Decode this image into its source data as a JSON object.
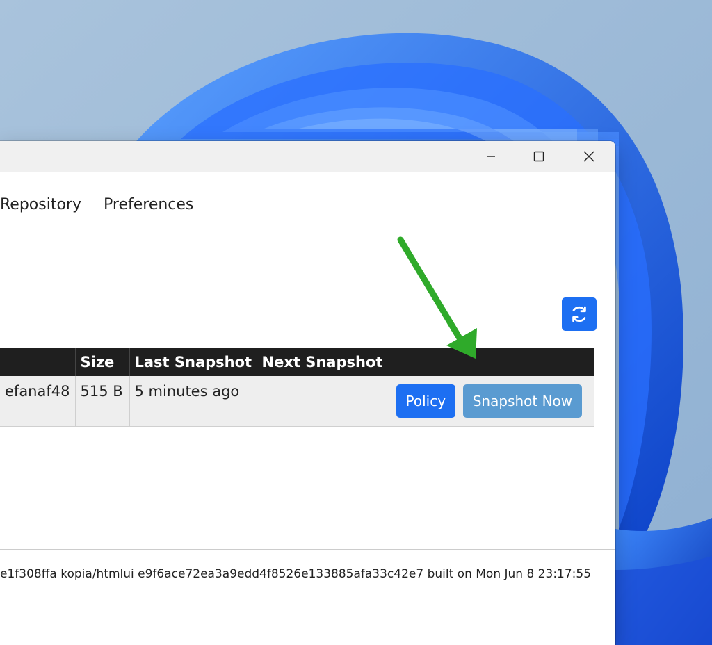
{
  "window": {
    "controls": {
      "minimize": "minimize",
      "maximize": "maximize",
      "close": "close"
    }
  },
  "nav": {
    "items": [
      "Repository",
      "Preferences"
    ]
  },
  "toolbar": {
    "refresh_icon": "refresh-icon"
  },
  "table": {
    "columns": [
      "",
      "Size",
      "Last Snapshot",
      "Next Snapshot",
      ""
    ],
    "rows": [
      {
        "id": "efanaf48",
        "size": "515 B",
        "last_snapshot": "5 minutes ago",
        "next_snapshot": "",
        "actions": [
          "Policy",
          "Snapshot Now"
        ]
      }
    ]
  },
  "footer": {
    "text": "e1f308ffa kopia/htmlui e9f6ace72ea3a9edd4f8526e133885afa33c42e7 built on Mon Jun 8 23:17:55"
  },
  "colors": {
    "primary_button": "#1d6ff2",
    "secondary_button": "#5a9bd1",
    "table_header": "#1f1f1f",
    "annotation_arrow": "#2faa2a"
  }
}
